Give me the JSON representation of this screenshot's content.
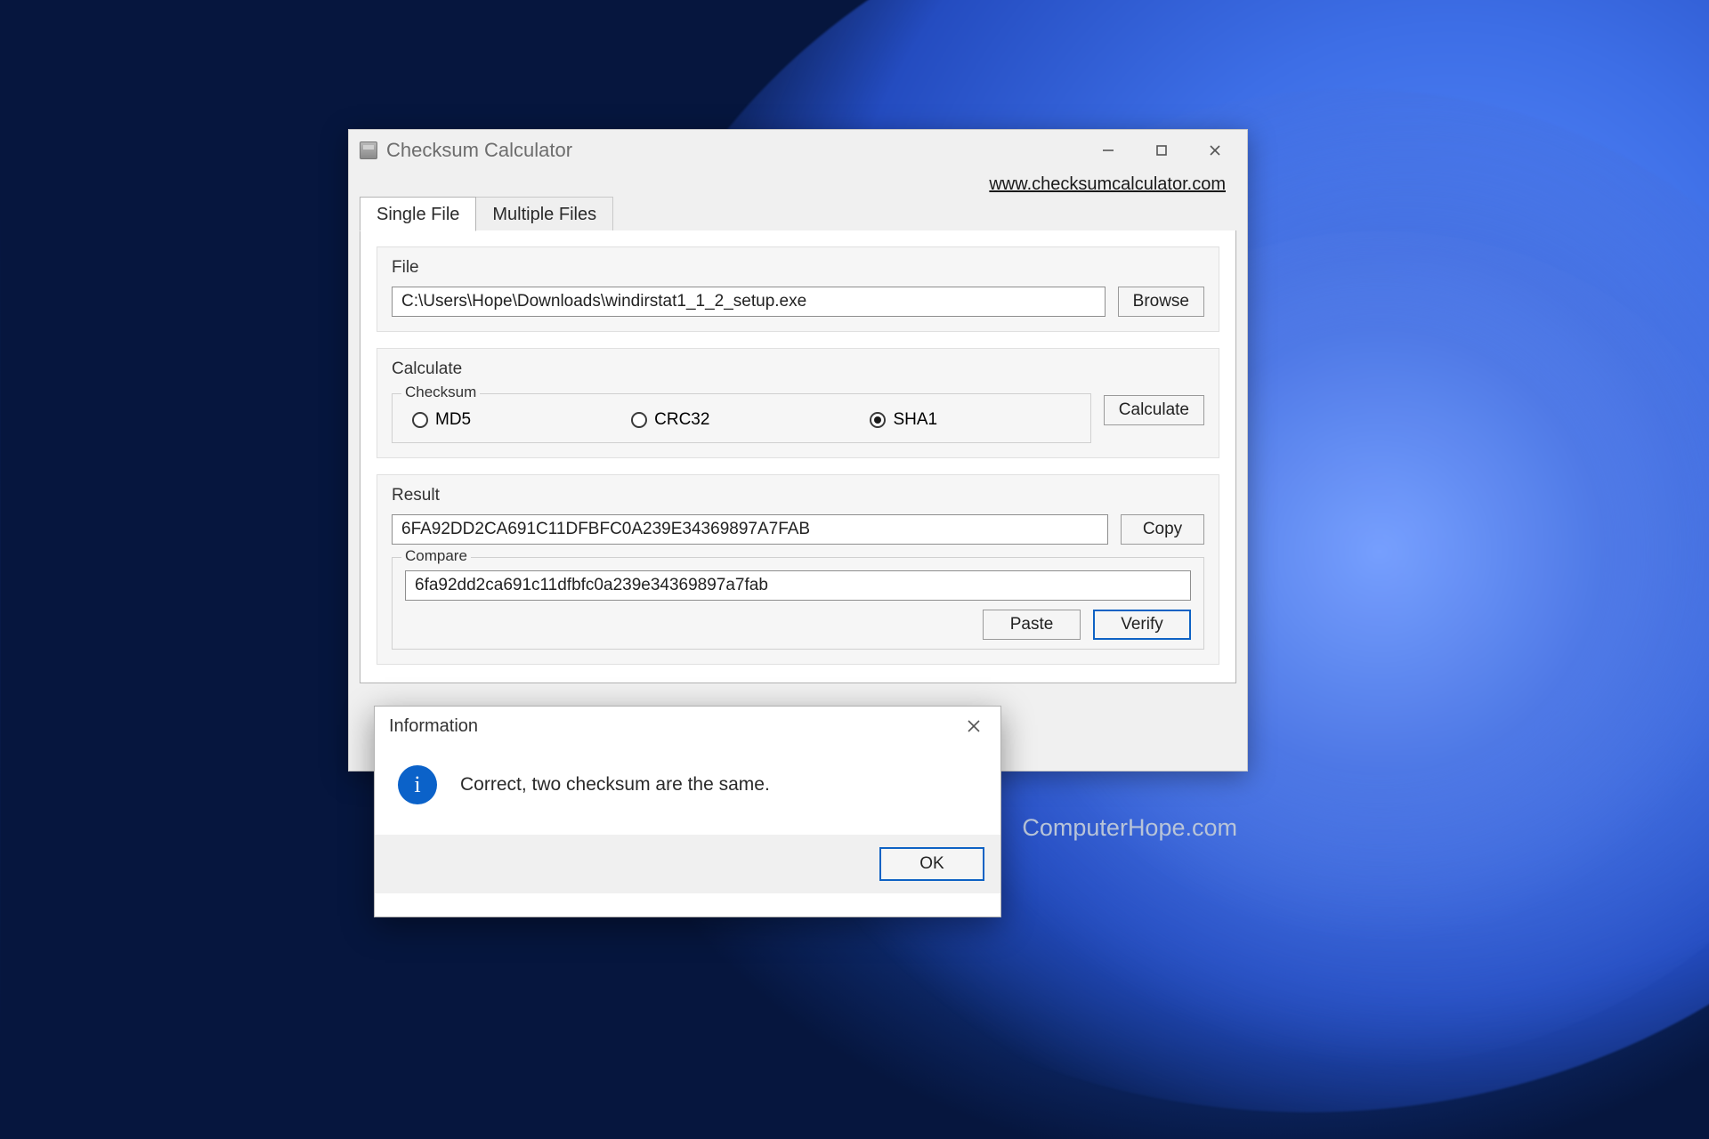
{
  "window": {
    "title": "Checksum Calculator",
    "link_label": "www.checksumcalculator.com"
  },
  "tabs": {
    "single": "Single File",
    "multiple": "Multiple Files"
  },
  "file_section": {
    "legend": "File",
    "path": "C:\\Users\\Hope\\Downloads\\windirstat1_1_2_setup.exe",
    "browse": "Browse"
  },
  "calculate_section": {
    "legend": "Calculate",
    "checksum_legend": "Checksum",
    "options": {
      "md5": "MD5",
      "crc32": "CRC32",
      "sha1": "SHA1"
    },
    "selected": "sha1",
    "calculate_btn": "Calculate"
  },
  "result_section": {
    "legend": "Result",
    "value": "6FA92DD2CA691C11DFBFC0A239E34369897A7FAB",
    "copy_btn": "Copy",
    "compare_legend": "Compare",
    "compare_value": "6fa92dd2ca691c11dfbfc0a239e34369897a7fab",
    "paste_btn": "Paste",
    "verify_btn": "Verify"
  },
  "dialog": {
    "title": "Information",
    "message": "Correct, two checksum are the same.",
    "ok": "OK"
  },
  "attribution": "ComputerHope.com"
}
